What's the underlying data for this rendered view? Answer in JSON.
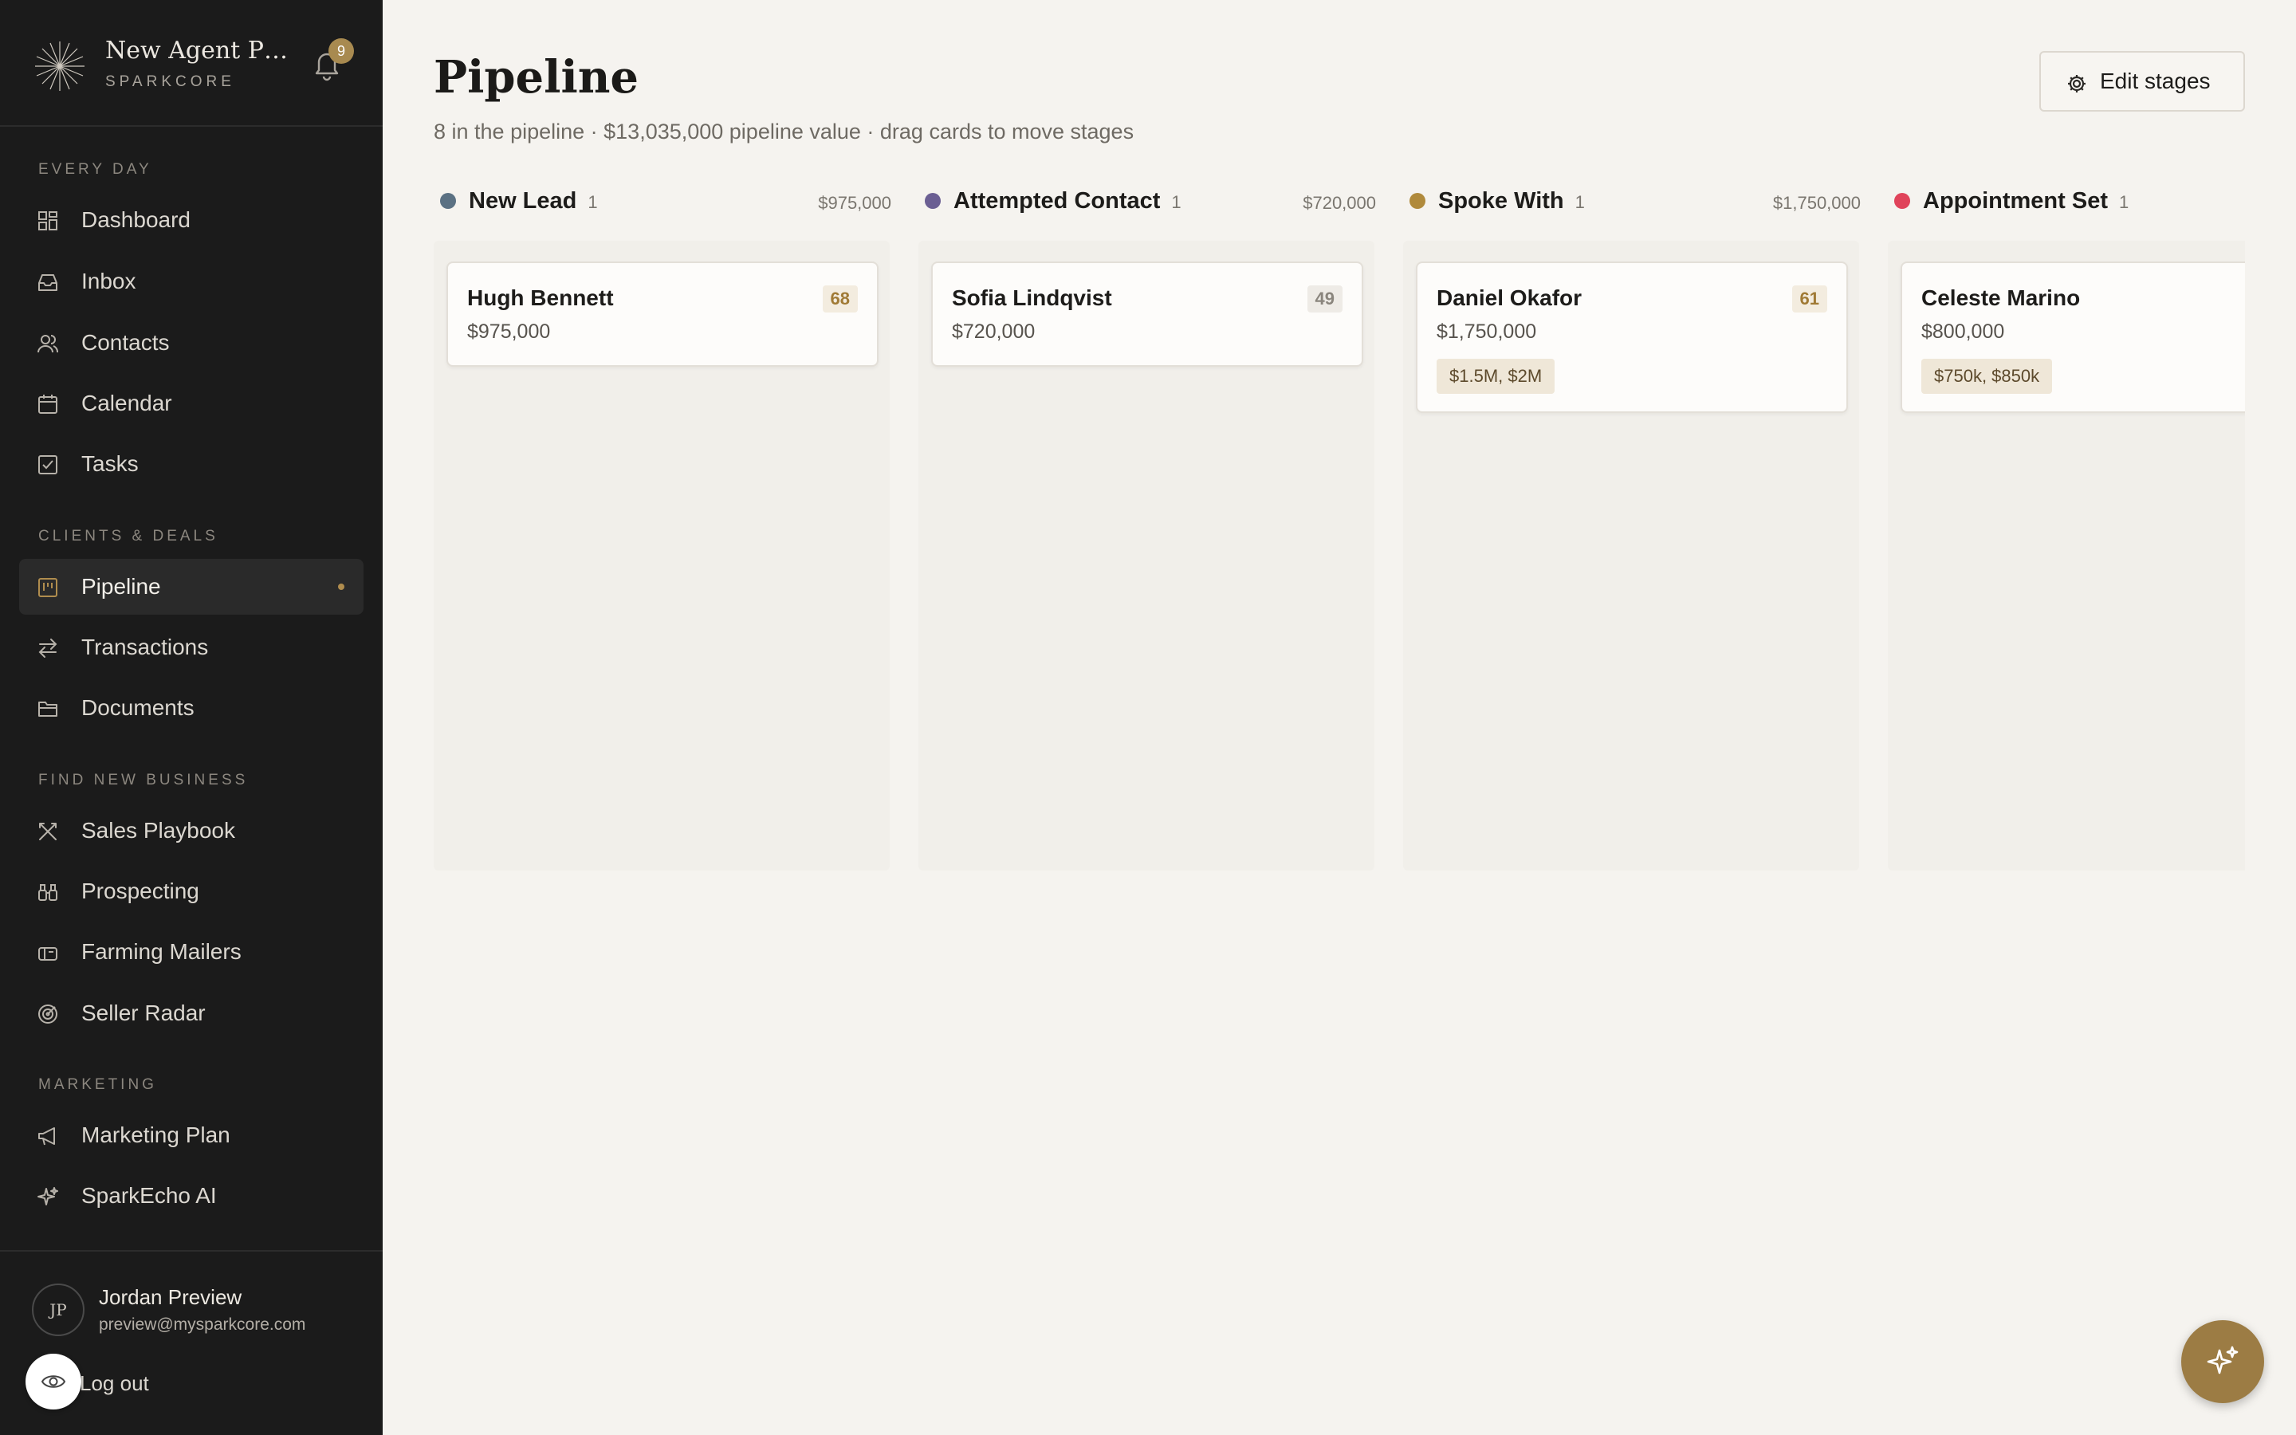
{
  "brand": {
    "name": "New Agent Pre...",
    "sub": "SPARKCORE",
    "notifications": "9"
  },
  "nav": {
    "sections": [
      {
        "label": "EVERY DAY"
      },
      {
        "label": "CLIENTS & DEALS"
      },
      {
        "label": "FIND NEW BUSINESS"
      },
      {
        "label": "MARKETING"
      }
    ],
    "items": [
      {
        "label": "Dashboard",
        "icon": "grid-icon"
      },
      {
        "label": "Inbox",
        "icon": "inbox-icon"
      },
      {
        "label": "Contacts",
        "icon": "users-icon"
      },
      {
        "label": "Calendar",
        "icon": "calendar-icon"
      },
      {
        "label": "Tasks",
        "icon": "checkbox-icon"
      },
      {
        "label": "Pipeline",
        "icon": "kanban-icon",
        "active": true
      },
      {
        "label": "Transactions",
        "icon": "arrows-icon"
      },
      {
        "label": "Documents",
        "icon": "folder-icon"
      },
      {
        "label": "Sales Playbook",
        "icon": "swords-icon"
      },
      {
        "label": "Prospecting",
        "icon": "binoculars-icon"
      },
      {
        "label": "Farming Mailers",
        "icon": "mailbox-icon"
      },
      {
        "label": "Seller Radar",
        "icon": "radar-icon"
      },
      {
        "label": "Marketing Plan",
        "icon": "megaphone-icon"
      },
      {
        "label": "SparkEcho AI",
        "icon": "sparkles-icon"
      }
    ]
  },
  "user": {
    "initials": "JP",
    "name": "Jordan Preview",
    "email": "preview@mysparkcore.com",
    "logout": "Log out"
  },
  "header": {
    "title": "Pipeline",
    "subtitle": "8 in the pipeline · $13,035,000 pipeline value · drag cards to move stages",
    "edit_button": "Edit stages"
  },
  "columns": [
    {
      "name": "New Lead",
      "count": "1",
      "total": "$975,000",
      "color": "#5b7183",
      "card": {
        "name": "Hugh Bennett",
        "value": "$975,000",
        "score": "68",
        "score_color": "#a07a35",
        "score_bg": "#f3ecdf",
        "tag": ""
      }
    },
    {
      "name": "Attempted Contact",
      "count": "1",
      "total": "$720,000",
      "color": "#6b5f93",
      "card": {
        "name": "Sofia Lindqvist",
        "value": "$720,000",
        "score": "49",
        "score_color": "#8a857d",
        "score_bg": "#eeebe6",
        "tag": ""
      }
    },
    {
      "name": "Spoke With",
      "count": "1",
      "total": "$1,750,000",
      "color": "#b08a3c",
      "card": {
        "name": "Daniel Okafor",
        "value": "$1,750,000",
        "score": "61",
        "score_color": "#a07a35",
        "score_bg": "#f3ecdf",
        "tag": "$1.5M, $2M"
      }
    },
    {
      "name": "Appointment Set",
      "count": "1",
      "total": "",
      "color": "#e0435a",
      "card": {
        "name": "Celeste Marino",
        "value": "$800,000",
        "score": "",
        "tag": "$750k, $850k"
      }
    }
  ],
  "colors": {
    "sidebar_bg": "#1b1b1b",
    "page_bg": "#f5f3ef",
    "accent": "#9c7c44"
  }
}
